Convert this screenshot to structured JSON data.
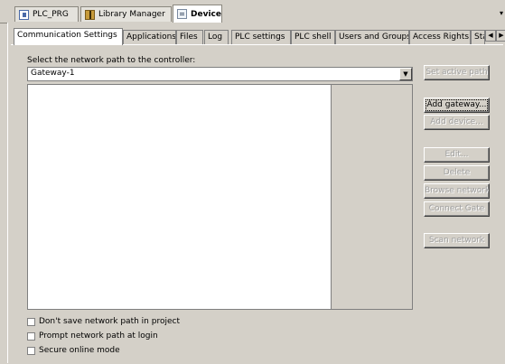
{
  "editor_tabs": [
    {
      "label": "PLC_PRG",
      "icon": "program-icon"
    },
    {
      "label": "Library Manager",
      "icon": "library-icon"
    },
    {
      "label": "Device",
      "icon": "device-icon"
    }
  ],
  "editor_tabs_menu": "▾",
  "page_tabs": [
    "Communication Settings",
    "Applications",
    "Files",
    "Log",
    "PLC settings",
    "PLC shell",
    "Users and Groups",
    "Access Rights",
    "Sta"
  ],
  "scroll": {
    "left": "◀",
    "right": "▶"
  },
  "network": {
    "label": "Select the network path to the controller:",
    "selected": "Gateway-1",
    "arrow": "▼"
  },
  "buttons": {
    "set_active_path": "Set active path",
    "add_gateway": "Add gateway...",
    "add_device": "Add device...",
    "edit": "Edit...",
    "delete": "Delete",
    "browse_network": "Browse network",
    "connect_gate": "Connect Gate",
    "scan_network": "Scan network"
  },
  "options": [
    {
      "label": "Don't save network path in project",
      "checked": false
    },
    {
      "label": "Prompt network path at login",
      "checked": false
    },
    {
      "label": "Secure online mode",
      "checked": false
    }
  ]
}
